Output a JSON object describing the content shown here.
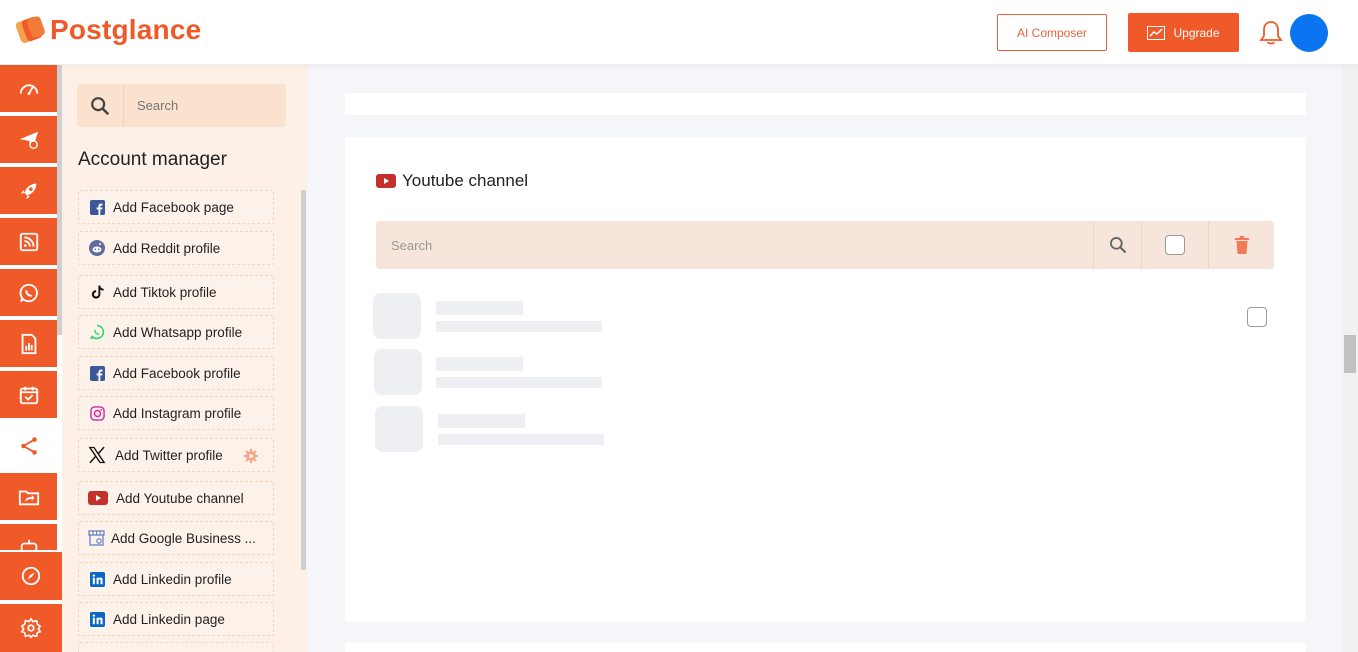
{
  "header": {
    "logo_text": "Postglance",
    "ai_composer_label": "AI Composer",
    "upgrade_label": "Upgrade",
    "brand_color": "#f05a28",
    "avatar_color": "#0b74f0"
  },
  "rail": {
    "items": [
      {
        "icon": "dashboard-icon"
      },
      {
        "icon": "send-icon"
      },
      {
        "icon": "rocket-icon"
      },
      {
        "icon": "rss-icon"
      },
      {
        "icon": "whatsapp-icon"
      },
      {
        "icon": "report-icon"
      },
      {
        "icon": "calendar-icon"
      },
      {
        "icon": "share-icon",
        "active": true
      },
      {
        "icon": "folder-share-icon"
      },
      {
        "icon": "robot-icon"
      }
    ],
    "bottom": [
      {
        "icon": "compass-icon"
      },
      {
        "icon": "gear-icon"
      }
    ]
  },
  "panel": {
    "search_placeholder": "Search",
    "title": "Account manager",
    "items": [
      {
        "label": "Add Facebook page",
        "icon": "facebook-icon"
      },
      {
        "label": "Add Reddit profile",
        "icon": "reddit-icon"
      },
      {
        "label": "Add Tiktok profile",
        "icon": "tiktok-icon"
      },
      {
        "label": "Add Whatsapp profile",
        "icon": "whatsapp-icon"
      },
      {
        "label": "Add Facebook profile",
        "icon": "facebook-icon"
      },
      {
        "label": "Add Instagram profile",
        "icon": "instagram-icon"
      },
      {
        "label": "Add Twitter profile",
        "icon": "x-icon"
      },
      {
        "label": "Add Youtube channel",
        "icon": "youtube-icon"
      },
      {
        "label": "Add Google Business ...",
        "icon": "google-business-icon"
      },
      {
        "label": "Add Linkedin profile",
        "icon": "linkedin-icon"
      },
      {
        "label": "Add Linkedin page",
        "icon": "linkedin-icon"
      }
    ]
  },
  "main": {
    "section_title": "Youtube channel",
    "search_placeholder": "Search"
  }
}
